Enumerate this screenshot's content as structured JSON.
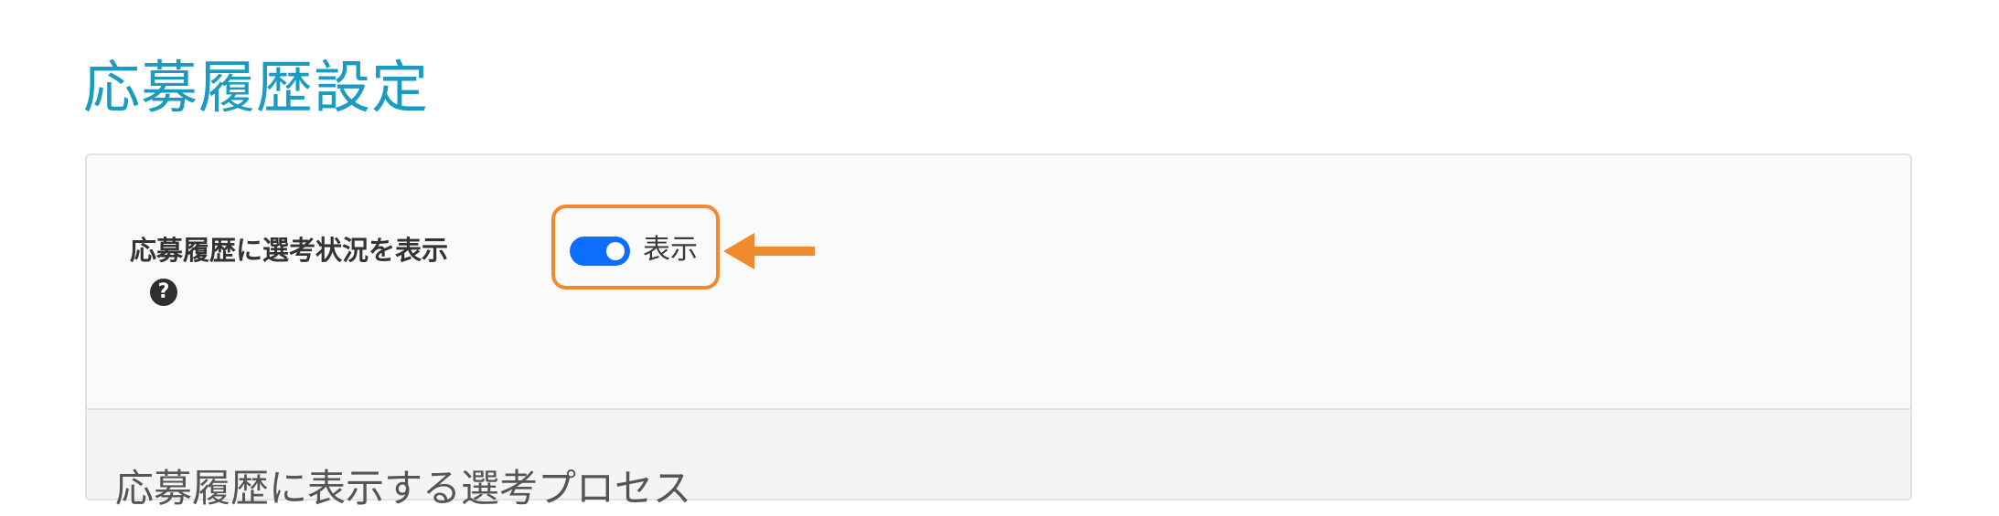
{
  "page": {
    "title": "応募履歴設定"
  },
  "setting": {
    "label": "応募履歴に選考状況を表示",
    "help_icon": "question-circle-icon",
    "toggle_on": true,
    "toggle_label": "表示"
  },
  "annotation": {
    "highlight_color": "#f08a2c",
    "arrow_icon": "arrow-left-icon"
  },
  "section": {
    "title": "応募履歴に表示する選考プロセス"
  },
  "colors": {
    "title": "#1a9bc2",
    "toggle_active": "#0d6efd"
  }
}
